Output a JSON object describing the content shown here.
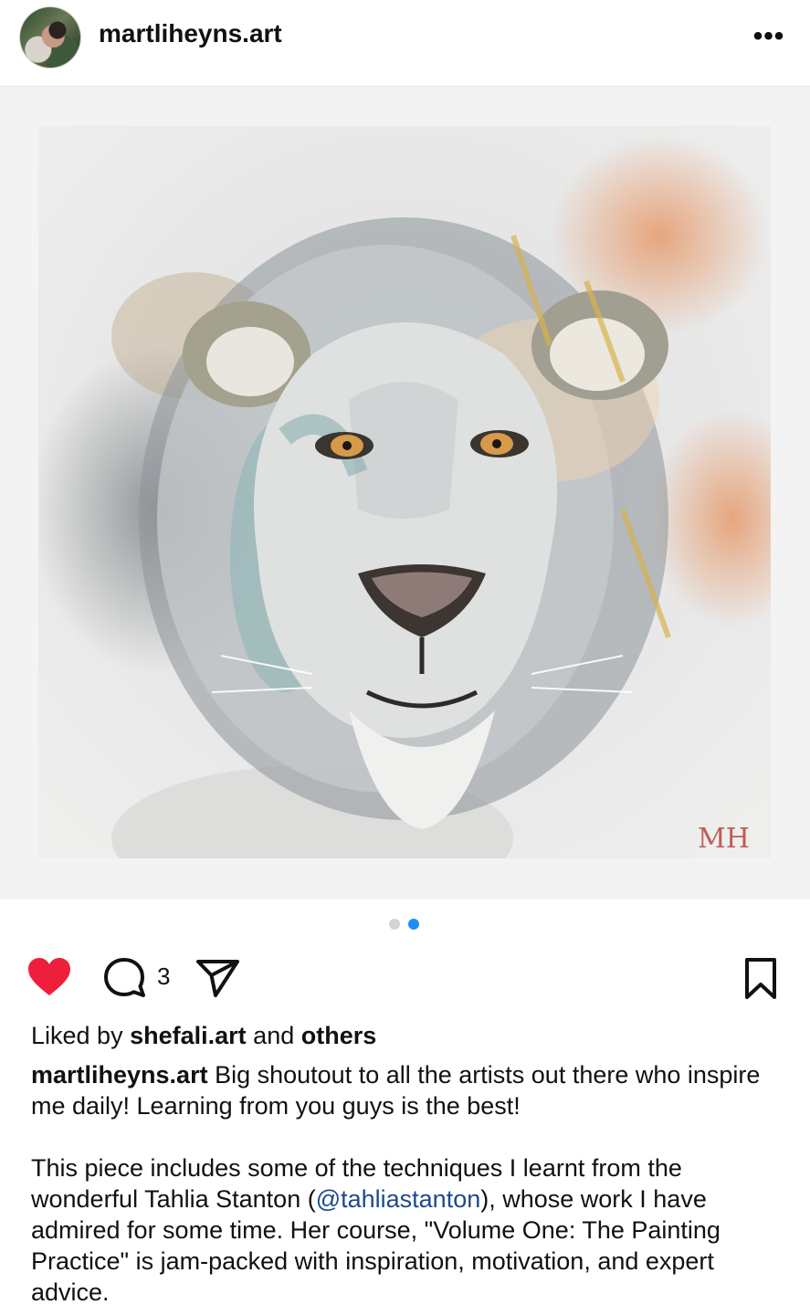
{
  "header": {
    "username": "martliheyns.art",
    "more_icon": "more-horizontal-icon",
    "more_label": "•••"
  },
  "media": {
    "description_icon": "painting-image",
    "signature_mark": "MH"
  },
  "carousel": {
    "current_index": 2,
    "total": 2,
    "active_color": "#1d8ff5",
    "inactive_color": "#d3d3d3"
  },
  "actions": {
    "like_icon": "heart-filled-icon",
    "like_color": "#ed1f3a",
    "comment_icon": "comment-icon",
    "comment_count": "3",
    "share_icon": "send-icon",
    "save_icon": "bookmark-icon"
  },
  "likes": {
    "prefix": "Liked by",
    "user": "shefali.art",
    "middle": "and",
    "others": "others"
  },
  "caption": {
    "author": "martliheyns.art",
    "text1": "Big shoutout to all the artists out there who inspire me daily! Learning from you guys is the best!",
    "p2_before": "This piece includes some of the techniques I learnt from the wonderful Tahlia Stanton (",
    "mention": "@tahliastanton",
    "p2_after": "), whose work I have admired for some time. Her course, \"Volume One: The Painting Practice\" is jam-packed with inspiration, motivation, and expert advice."
  }
}
